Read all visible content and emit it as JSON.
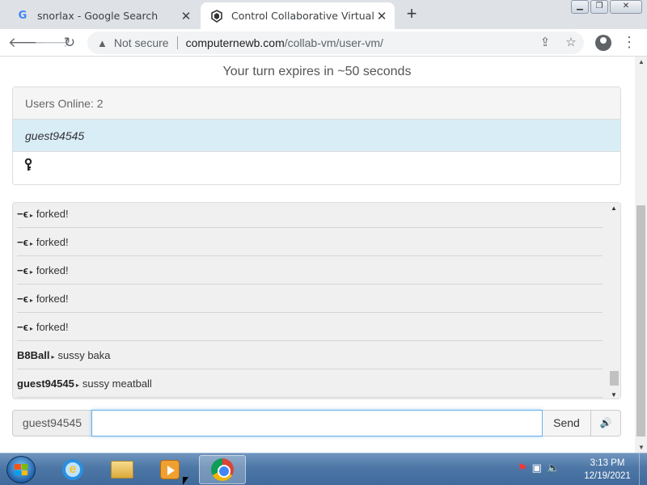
{
  "browser": {
    "tabs": [
      {
        "favicon": "google-icon",
        "title": "snorlax - Google Search",
        "active": false
      },
      {
        "favicon": "collabvm-icon",
        "title": "Control Collaborative Virtual Ma",
        "active": true
      }
    ],
    "address": {
      "security_label": "Not secure",
      "host": "computernewb.com",
      "path": "/collab-vm/user-vm/"
    }
  },
  "page": {
    "turn_notice": "Your turn expires in ~50 seconds",
    "users": {
      "header": "Users Online: 2",
      "list": [
        "guest94545"
      ],
      "second_row_icon": "key-icon"
    },
    "chat": {
      "messages": [
        {
          "user": "−ϵ",
          "text": "forked!"
        },
        {
          "user": "−ϵ",
          "text": "forked!"
        },
        {
          "user": "−ϵ",
          "text": "forked!"
        },
        {
          "user": "−ϵ",
          "text": "forked!"
        },
        {
          "user": "−ϵ",
          "text": "forked!"
        },
        {
          "user": "B8Ball",
          "text": "sussy baka"
        },
        {
          "user": "guest94545",
          "text": "sussy meatball"
        }
      ]
    },
    "input": {
      "username": "guest94545",
      "value": "",
      "send_label": "Send",
      "audio_icon": "volume-icon"
    }
  },
  "taskbar": {
    "items": [
      "start-orb",
      "internet-explorer",
      "windows-explorer",
      "media-player",
      "google-chrome"
    ],
    "active_item": "google-chrome",
    "time": "3:13 PM",
    "date": "12/19/2021"
  }
}
